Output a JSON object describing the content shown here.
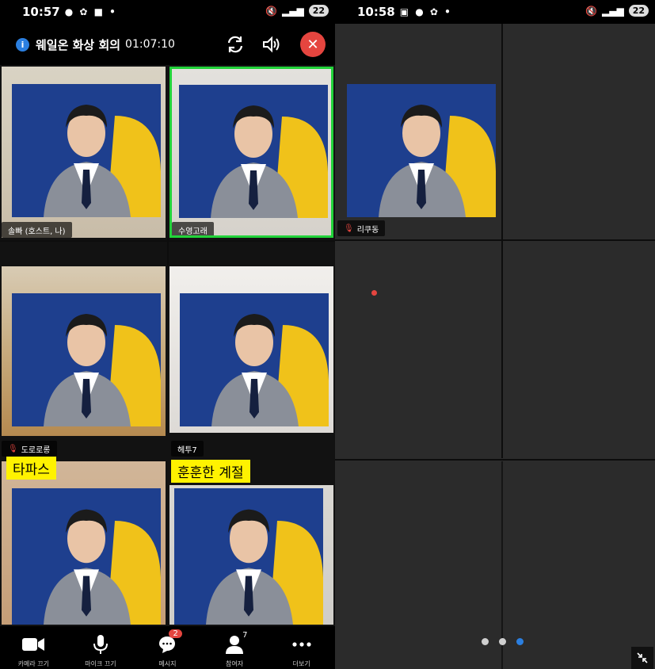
{
  "left_status": {
    "time": "10:57",
    "battery": "22"
  },
  "right_status": {
    "time": "10:58",
    "battery": "22"
  },
  "meeting": {
    "title": "웨일온 화상 회의",
    "timer": "01:07:10"
  },
  "participants": [
    {
      "name": "솔빠 (호스트, 나)",
      "muted": false,
      "speaking": false
    },
    {
      "name": "수영고래",
      "muted": false,
      "speaking": true
    },
    {
      "name": "리쿠동",
      "muted": true,
      "speaking": false
    },
    {
      "name": "도로로롱",
      "muted": true,
      "speaking": false
    },
    {
      "name": "헤투7",
      "muted": false,
      "speaking": false
    }
  ],
  "stickers": {
    "tile5": "타파스",
    "tile6": "훈훈한 계절"
  },
  "toolbar": {
    "camera": "카메라 끄기",
    "mic": "마이크 끄기",
    "message": "메시지",
    "message_badge": "2",
    "participants": "참여자",
    "participants_count": "7",
    "more": "더보기"
  },
  "colors": {
    "accent": "#2b7fe0",
    "leave": "#e5453f",
    "speaking_border": "#22d33a",
    "sticker": "#fff200"
  }
}
